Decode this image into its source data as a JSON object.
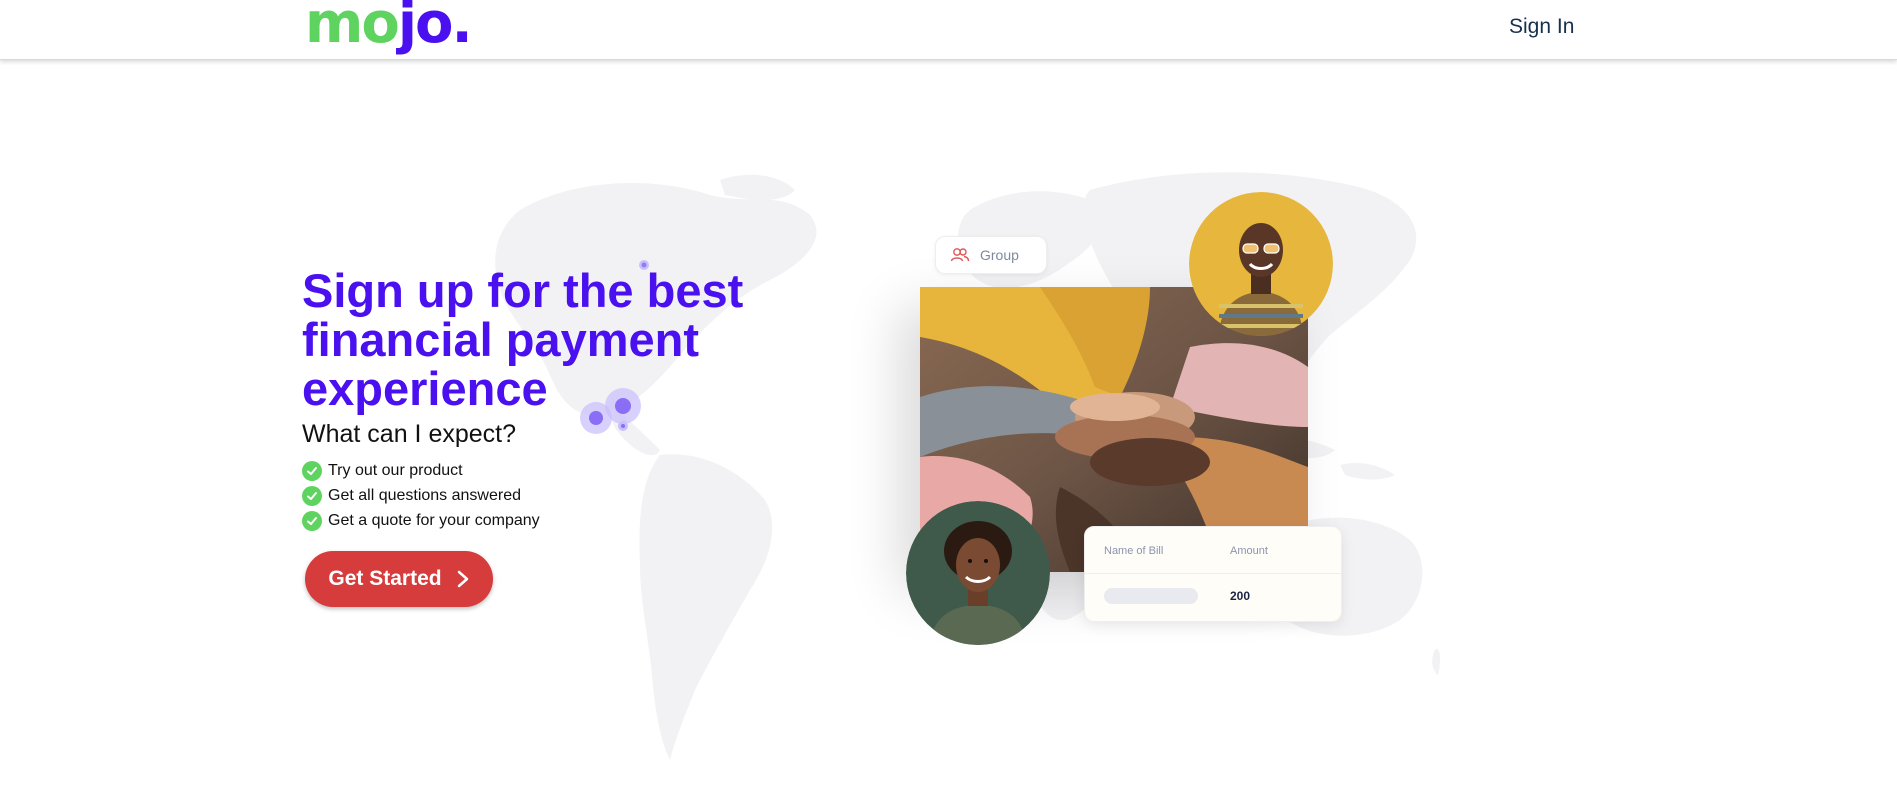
{
  "header": {
    "logo_part1": "mo",
    "logo_part2": "jo",
    "logo_dot": ".",
    "signin_label": "Sign In"
  },
  "hero": {
    "headline": "Sign up for the best financial payment experience",
    "subheading": "What can I expect?",
    "checklist": [
      "Try out our product",
      "Get all questions answered",
      "Get a quote for your company"
    ],
    "cta_label": "Get Started"
  },
  "illustration": {
    "group_chip_label": "Group",
    "bill_card": {
      "col1_header": "Name of Bill",
      "col2_header": "Amount",
      "amount_value": "200"
    }
  },
  "icons": {
    "check": "check-icon",
    "chevron": "chevron-right-icon",
    "group": "group-icon"
  },
  "colors": {
    "brand_purple": "#4a10f0",
    "brand_green": "#5fd35f",
    "cta_red": "#d63c3c",
    "nav_text": "#16304d"
  }
}
